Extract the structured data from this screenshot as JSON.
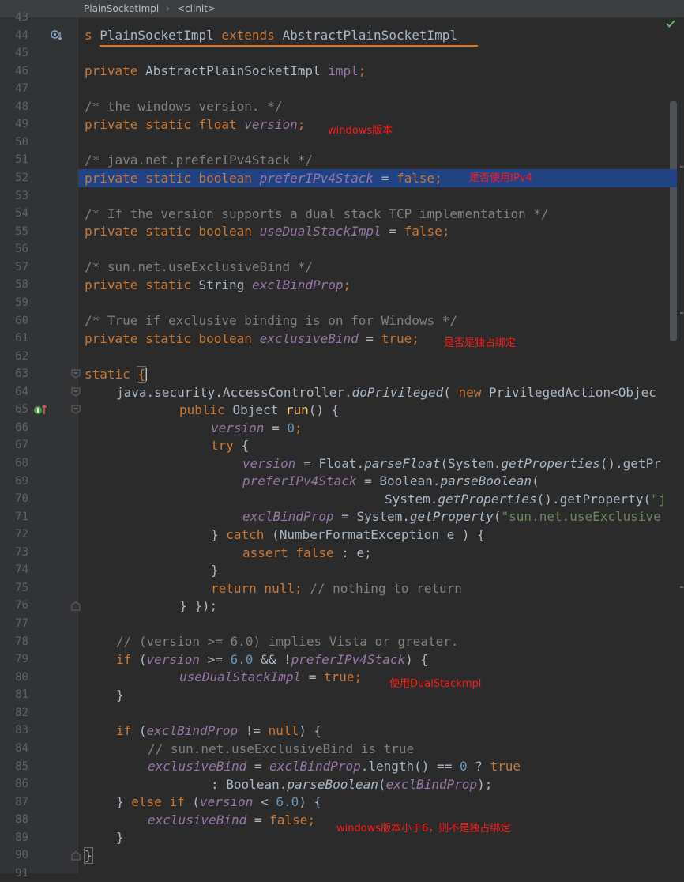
{
  "breadcrumb": {
    "class_name": "PlainSocketImpl",
    "separator": "›",
    "method": "<clinit>"
  },
  "line_numbers": [
    "43",
    "44",
    "45",
    "46",
    "47",
    "48",
    "49",
    "50",
    "51",
    "52",
    "53",
    "54",
    "55",
    "56",
    "57",
    "58",
    "59",
    "60",
    "61",
    "62",
    "63",
    "64",
    "65",
    "66",
    "67",
    "68",
    "69",
    "70",
    "71",
    "72",
    "73",
    "74",
    "75",
    "76",
    "77",
    "78",
    "79",
    "80",
    "81",
    "82",
    "83",
    "84",
    "85",
    "86",
    "87",
    "88",
    "89",
    "90",
    "91"
  ],
  "annotations": {
    "version": "windows版本",
    "preferIPv4": "是否使用IPv4",
    "exclusive": "是否是独占绑定",
    "dualstack": "使用DualStackmpl",
    "lt6": "windows版本小于6，则不是独占绑定"
  },
  "code": {
    "l44": {
      "a": "s ",
      "b": "PlainSocketImpl ",
      "c": "extends ",
      "d": "AbstractPlainSocketImpl"
    },
    "l46": {
      "a": "private ",
      "b": "AbstractPlainSocketImpl ",
      "c": "impl",
      "d": ";"
    },
    "l48": "/* the windows version. */",
    "l49": {
      "a": "private static float ",
      "b": "version",
      "c": ";"
    },
    "l51": "/* java.net.preferIPv4Stack */",
    "l52": {
      "a": "private static boolean ",
      "b": "preferIPv4Stack",
      "c": " = ",
      "d": "false",
      "e": ";"
    },
    "l54": "/* If the version supports a dual stack TCP implementation */",
    "l55": {
      "a": "private static boolean ",
      "b": "useDualStackImpl",
      "c": " = ",
      "d": "false",
      "e": ";"
    },
    "l57": "/* sun.net.useExclusiveBind */",
    "l58": {
      "a": "private static ",
      "b": "String ",
      "c": "exclBindProp",
      "d": ";"
    },
    "l60": "/* True if exclusive binding is on for Windows */",
    "l61": {
      "a": "private static boolean ",
      "b": "exclusiveBind",
      "c": " = ",
      "d": "true",
      "e": ";"
    },
    "l63": {
      "a": "static ",
      "b": "{"
    },
    "l64": {
      "a": "java.security.AccessController.",
      "b": "doPrivileged",
      "c": "( ",
      "d": "new ",
      "e": "PrivilegedAction<Objec"
    },
    "l65": {
      "a": "public ",
      "b": "Object ",
      "c": "run",
      "d": "() {"
    },
    "l66": {
      "a": "version",
      "b": " = ",
      "c": "0",
      "d": ";"
    },
    "l67": {
      "a": "try ",
      "b": "{"
    },
    "l68": {
      "a": "version",
      "b": " = Float.",
      "c": "parseFloat",
      "d": "(System.",
      "e": "getProperties",
      "f": "().getPr"
    },
    "l69": {
      "a": "preferIPv4Stack",
      "b": " = Boolean.",
      "c": "parseBoolean",
      "d": "("
    },
    "l70": {
      "a": "System.",
      "b": "getProperties",
      "c": "().getProperty(",
      "d": "\"j"
    },
    "l71": {
      "a": "exclBindProp",
      "b": " = System.",
      "c": "getProperty",
      "d": "(",
      "e": "\"sun.net.useExclusive"
    },
    "l72": {
      "a": "} ",
      "b": "catch ",
      "c": "(NumberFormatException e ) {"
    },
    "l73": {
      "a": "assert false ",
      "b": ": e;"
    },
    "l74": "}",
    "l75": {
      "a": "return null",
      "b": "; ",
      "c": "// nothing to return"
    },
    "l76": "} });",
    "l78": "// (version >= 6.0) implies Vista or greater.",
    "l79": {
      "a": "if ",
      "b": "(",
      "c": "version",
      "d": " >= ",
      "e": "6.0",
      "f": " && !",
      "g": "preferIPv4Stack",
      "h": ") {"
    },
    "l80": {
      "a": "useDualStackImpl",
      "b": " = ",
      "c": "true",
      "d": ";"
    },
    "l81": "}",
    "l83": {
      "a": "if ",
      "b": "(",
      "c": "exclBindProp",
      "d": " != ",
      "e": "null",
      "f": ") {"
    },
    "l84": "// sun.net.useExclusiveBind is true",
    "l85": {
      "a": "exclusiveBind",
      "b": " = ",
      "c": "exclBindProp",
      "d": ".length() == ",
      "e": "0",
      "f": " ? ",
      "g": "true"
    },
    "l86": {
      "a": ": Boolean.",
      "b": "parseBoolean",
      "c": "(",
      "d": "exclBindProp",
      "e": ");"
    },
    "l87": {
      "a": "} ",
      "b": "else if ",
      "c": "(",
      "d": "version",
      "e": " < ",
      "f": "6.0",
      "g": ") {"
    },
    "l88": {
      "a": "exclusiveBind",
      "b": " = ",
      "c": "false",
      "d": ";"
    },
    "l89": "}",
    "l90": "}"
  },
  "colors": {
    "background": "#2b2b2b",
    "gutter": "#313335",
    "keyword": "#cc7832",
    "field": "#9876aa",
    "comment": "#808080",
    "number": "#6897bb",
    "string": "#6a8759",
    "method": "#ffc66d",
    "selection": "#214283",
    "annotation": "#ff1a1a",
    "underline": "#e8750c"
  },
  "icons": {
    "override": "gutter-override-icon",
    "implements": "gutter-implements-icon",
    "inspection_ok": "check-icon"
  }
}
